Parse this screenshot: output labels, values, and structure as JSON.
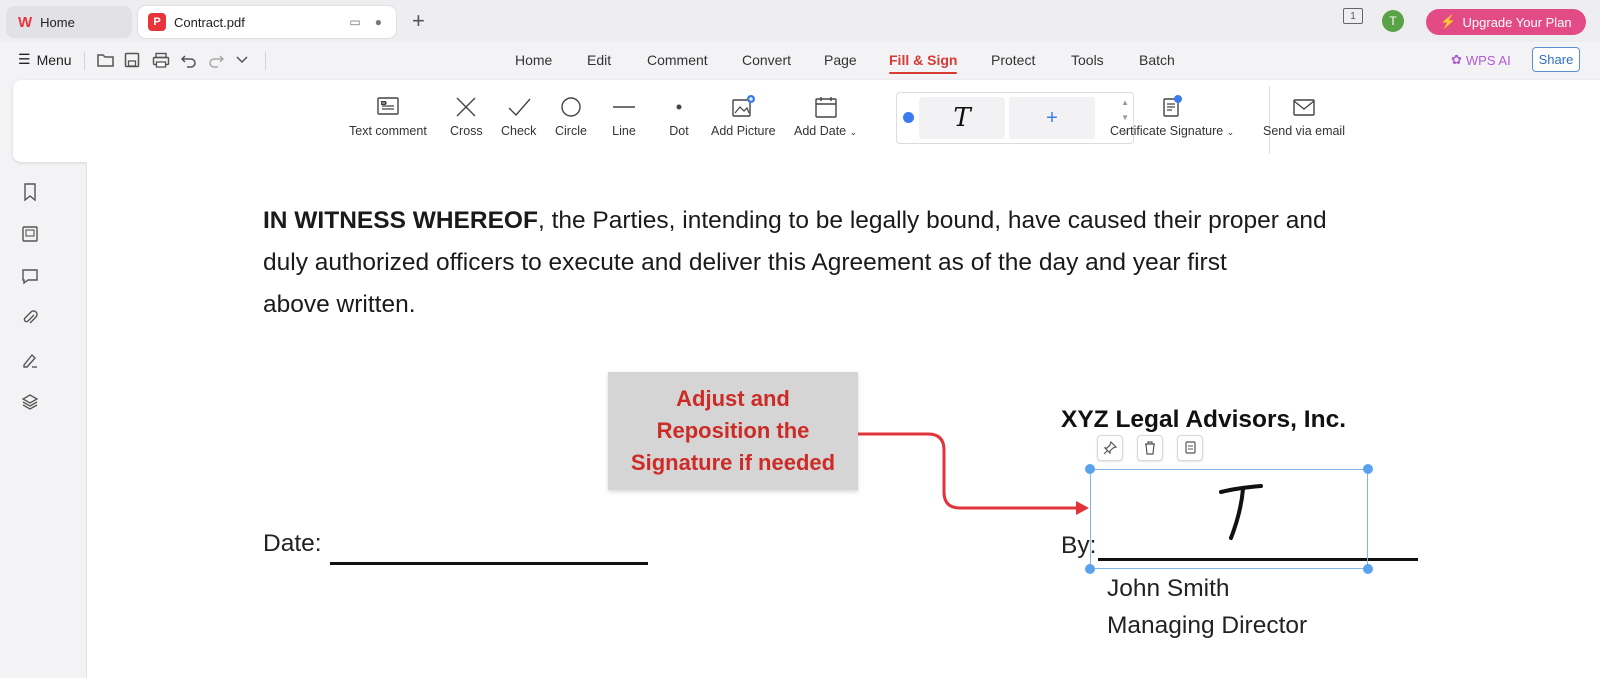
{
  "tabs": {
    "home_label": "Home",
    "doc_label": "Contract.pdf"
  },
  "topbar": {
    "window_badge": "1",
    "avatar_initial": "T",
    "upgrade_label": "Upgrade Your Plan"
  },
  "menu": {
    "menu_label": "Menu",
    "nav": [
      "Home",
      "Edit",
      "Comment",
      "Convert",
      "Page",
      "Fill & Sign",
      "Protect",
      "Tools",
      "Batch"
    ],
    "active_tab": "Fill & Sign",
    "wps_ai_label": "WPS AI",
    "share_label": "Share"
  },
  "ribbon": {
    "tools": [
      "Text comment",
      "Cross",
      "Check",
      "Circle",
      "Line",
      "Dot",
      "Add Picture",
      "Add Date"
    ],
    "signature_preview": "T",
    "add_signature": "+",
    "certificate_label": "Certificate Signature",
    "send_label": "Send via email"
  },
  "document": {
    "para_bold": "IN WITNESS WHEREOF",
    "para_line1": ", the Parties, intending to be legally bound, have caused their proper and",
    "para_line2": "duly authorized officers to execute and deliver this Agreement as of the day and year first",
    "para_line3": "above written.",
    "callout_line1": "Adjust and",
    "callout_line2": "Reposition the",
    "callout_line3": "Signature if needed",
    "date_label": "Date:",
    "company": "XYZ Legal Advisors, Inc.",
    "by_label": "By:",
    "signer_name": "John Smith",
    "signer_title": "Managing Director"
  },
  "colors": {
    "accent_red": "#d83a34",
    "callout_text": "#cc2b26",
    "selection_blue": "#5aa2ee",
    "upgrade_pink": "#e34b86"
  }
}
